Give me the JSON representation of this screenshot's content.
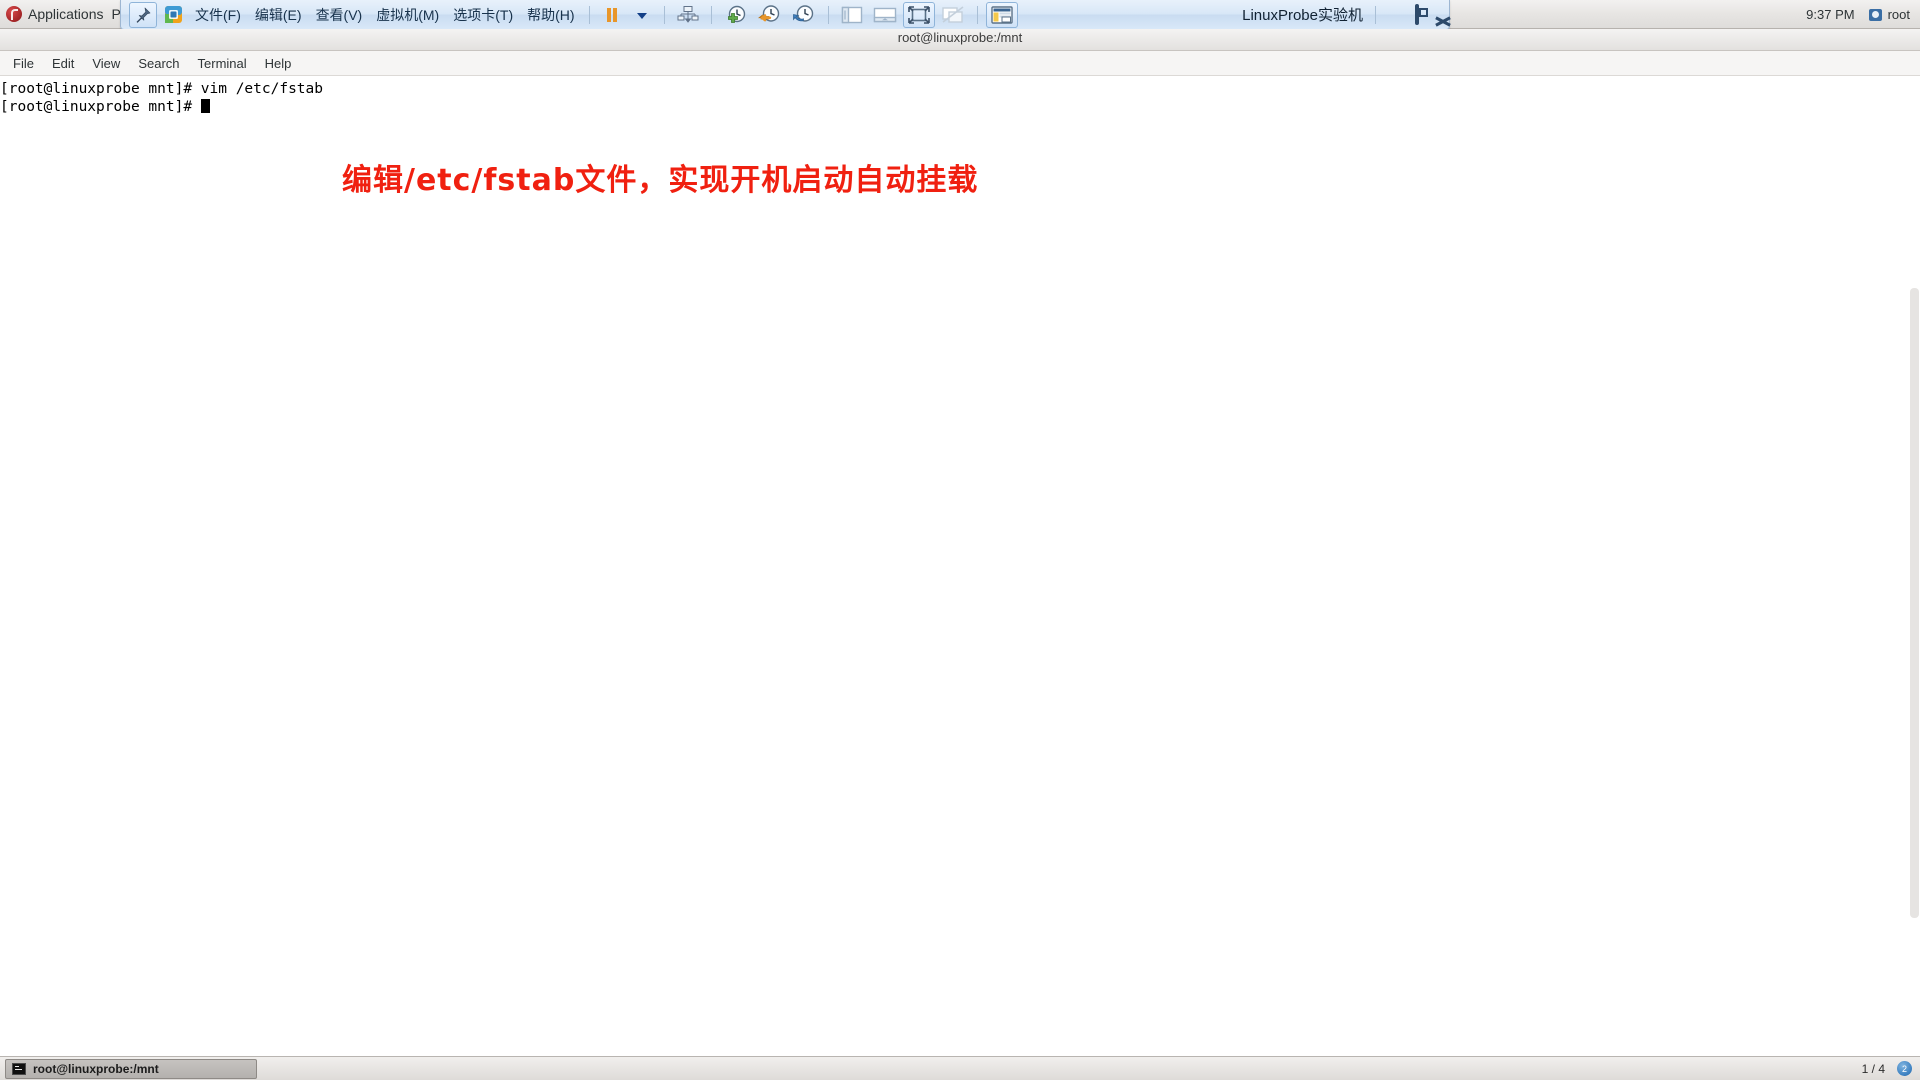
{
  "gnome_panel": {
    "applications_label": "Applications",
    "places_label": "Pl",
    "clock": "9:37 PM",
    "user": "root",
    "fedora_icon": "fedora-logo-icon",
    "user_icon": "user-account-icon"
  },
  "vmware": {
    "pin_icon": "pin-icon",
    "app_icon": "vmware-workstation-icon",
    "menus": [
      {
        "label": "文件(F)",
        "name": "menu-file"
      },
      {
        "label": "编辑(E)",
        "name": "menu-edit"
      },
      {
        "label": "查看(V)",
        "name": "menu-view"
      },
      {
        "label": "虚拟机(M)",
        "name": "menu-vm"
      },
      {
        "label": "选项卡(T)",
        "name": "menu-tabs"
      },
      {
        "label": "帮助(H)",
        "name": "menu-help"
      }
    ],
    "toolbar_icons": [
      {
        "name": "suspend-icon",
        "title": "挂起"
      },
      {
        "name": "power-dropdown-icon",
        "title": "电源选项"
      },
      {
        "name": "snapshot-manager-icon",
        "title": "快照管理器"
      },
      {
        "name": "take-snapshot-icon",
        "title": "拍摄此虚拟机的快照"
      },
      {
        "name": "revert-snapshot-icon",
        "title": "恢复到上一快照"
      },
      {
        "name": "manage-snapshots-icon",
        "title": "管理快照"
      },
      {
        "name": "show-sidebar-icon",
        "title": "显示或隐藏库"
      },
      {
        "name": "show-thumbnail-bar-icon",
        "title": "显示或隐藏缩略图栏"
      },
      {
        "name": "fullscreen-icon",
        "title": "进入全屏模式"
      },
      {
        "name": "unity-mode-icon",
        "title": "进入 Unity 模式"
      },
      {
        "name": "console-view-icon",
        "title": "控制台视图"
      }
    ],
    "title": "LinuxProbe实验机",
    "window_buttons": [
      {
        "name": "vmware-minimize-button",
        "glyph": "minimize"
      },
      {
        "name": "vmware-restore-button",
        "glyph": "restore"
      },
      {
        "name": "vmware-close-button",
        "glyph": "close"
      }
    ]
  },
  "terminal": {
    "title": "root@linuxprobe:/mnt",
    "menus": [
      {
        "label": "File",
        "name": "terminal-menu-file"
      },
      {
        "label": "Edit",
        "name": "terminal-menu-edit"
      },
      {
        "label": "View",
        "name": "terminal-menu-view"
      },
      {
        "label": "Search",
        "name": "terminal-menu-search"
      },
      {
        "label": "Terminal",
        "name": "terminal-menu-terminal"
      },
      {
        "label": "Help",
        "name": "terminal-menu-help"
      }
    ],
    "lines": [
      "[root@linuxprobe mnt]# vim /etc/fstab",
      "[root@linuxprobe mnt]# "
    ],
    "line1": "[root@linuxprobe mnt]# vim /etc/fstab",
    "line2": "[root@linuxprobe mnt]# "
  },
  "annotation": {
    "text": "编辑/etc/fstab文件，实现开机启动自动挂载",
    "color": "#f02010"
  },
  "taskbar": {
    "window_label": "root@linuxprobe:/mnt",
    "window_icon": "terminal-icon",
    "workspace_label": "1 / 4",
    "workspace_button": "2"
  }
}
